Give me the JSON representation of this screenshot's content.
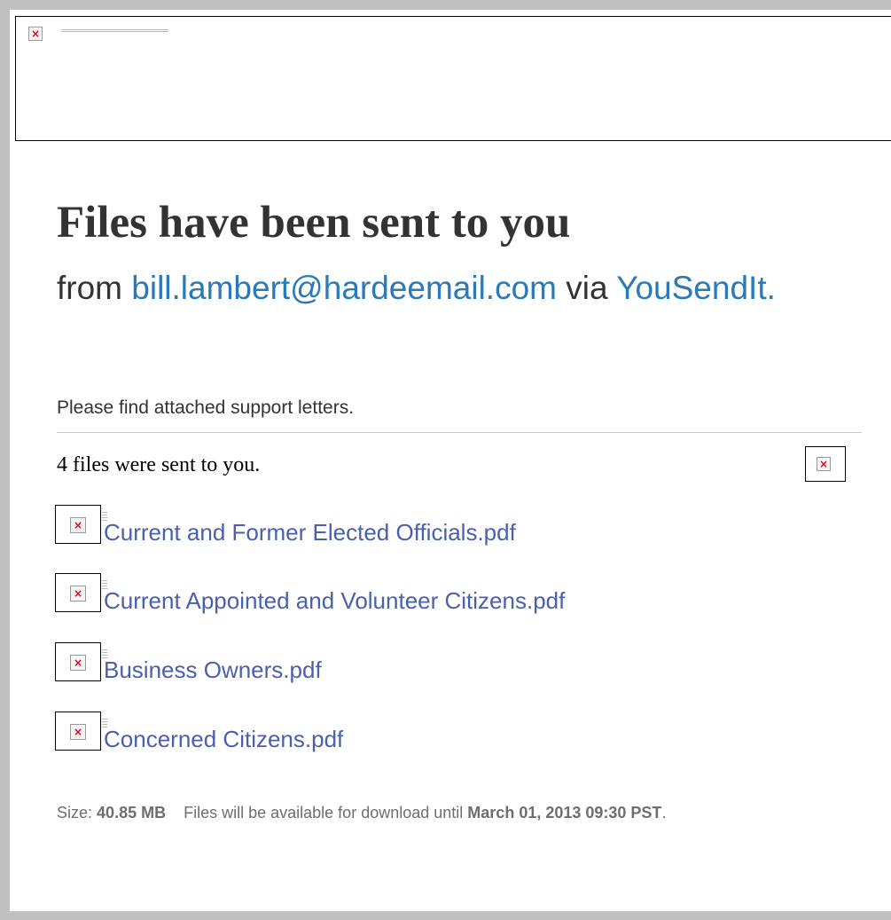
{
  "headline": "Files have been sent to you",
  "from": {
    "prefix": "from",
    "sender_email": "bill.lambert@hardeemail.com",
    "via": "via",
    "service": "YouSendIt."
  },
  "message": "Please find attached support letters.",
  "files_count_text": "4 files were sent to you.",
  "files": [
    {
      "name": "Current and Former Elected Officials.pdf"
    },
    {
      "name": "Current Appointed and Volunteer Citizens.pdf"
    },
    {
      "name": "Business Owners.pdf"
    },
    {
      "name": "Concerned Citizens.pdf"
    }
  ],
  "footer": {
    "size_label": "Size:",
    "size_value": "40.85 MB",
    "availability_text": "Files will be available for download until",
    "expiry": "March 01, 2013 09:30 PST",
    "end_punct": "."
  },
  "colors": {
    "link": "#2a7ab8",
    "file_link": "#4a5fb0",
    "text": "#333333",
    "broken_image_x": "#e2001a"
  },
  "icons": {
    "broken_image": "broken-image-icon"
  }
}
